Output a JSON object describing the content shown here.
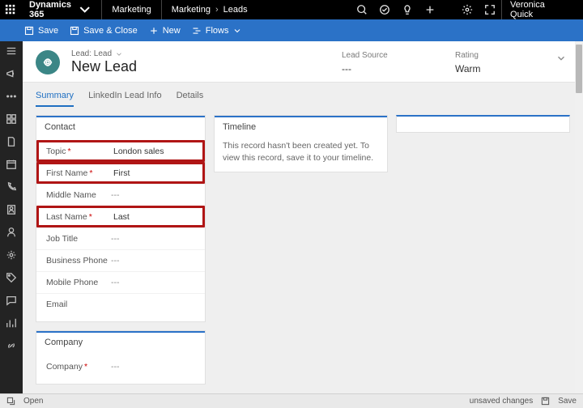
{
  "top": {
    "brand": "Dynamics 365",
    "app": "Marketing",
    "crumb1": "Marketing",
    "crumb2": "Leads",
    "user": "Veronica Quick"
  },
  "cmd": {
    "save": "Save",
    "saveclose": "Save & Close",
    "new": "New",
    "flows": "Flows"
  },
  "header": {
    "entity": "Lead: Lead",
    "title": "New Lead",
    "leadsource_lbl": "Lead Source",
    "leadsource_val": "---",
    "rating_lbl": "Rating",
    "rating_val": "Warm"
  },
  "tabs": {
    "summary": "Summary",
    "linkedin": "LinkedIn Lead Info",
    "details": "Details"
  },
  "contact": {
    "title": "Contact",
    "fields": {
      "topic_lbl": "Topic",
      "topic_val": "London sales",
      "first_lbl": "First Name",
      "first_val": "First",
      "middle_lbl": "Middle Name",
      "middle_val": "---",
      "last_lbl": "Last Name",
      "last_val": "Last",
      "job_lbl": "Job Title",
      "job_val": "---",
      "bphone_lbl": "Business Phone",
      "bphone_val": "---",
      "mphone_lbl": "Mobile Phone",
      "mphone_val": "---",
      "email_lbl": "Email",
      "email_val": ""
    }
  },
  "company": {
    "title": "Company",
    "company_lbl": "Company",
    "company_val": "---"
  },
  "timeline": {
    "title": "Timeline",
    "msg": "This record hasn't been created yet. To view this record, save it to your timeline."
  },
  "footer": {
    "open": "Open",
    "unsaved": "unsaved changes",
    "save": "Save"
  }
}
